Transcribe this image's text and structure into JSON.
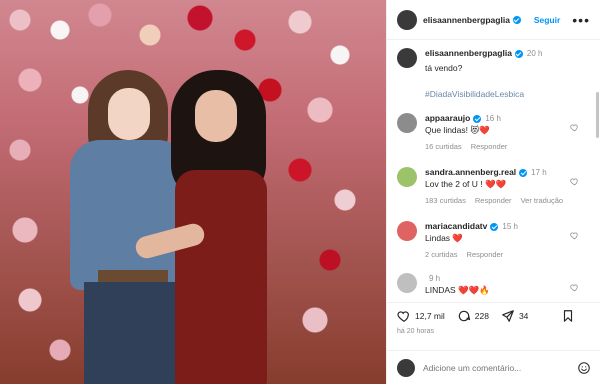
{
  "post": {
    "author": "elisaannenbergpaglia",
    "follow_label": "Seguir",
    "more_label": "•••",
    "caption_time": "20 h",
    "caption_text": "tá vendo?",
    "hashtag": "#DiadaVisibilidadeLesbica",
    "likes": "12,7 mil",
    "comments_count": "228",
    "shares": "34",
    "posted_ago": "há 20 horas",
    "add_comment_placeholder": "Adicione um comentário..."
  },
  "comments": [
    {
      "user": "appaaraujo",
      "verified": true,
      "time": "16 h",
      "text": "Que lindas! 😻❤️",
      "likes": "16 curtidas",
      "reply": "Responder",
      "translate": ""
    },
    {
      "user": "sandra.annenberg.real",
      "verified": true,
      "time": "17 h",
      "text": "Lov the 2 of U ! ❤️❤️",
      "likes": "183 curtidas",
      "reply": "Responder",
      "translate": "Ver tradução"
    },
    {
      "user": "mariacandidatv",
      "verified": true,
      "time": "15 h",
      "text": "Lindas ❤️",
      "likes": "2 curtidas",
      "reply": "Responder",
      "translate": ""
    },
    {
      "user": "",
      "verified": false,
      "time": "9 h",
      "text": "LINDAS ❤️❤️🔥",
      "likes": "",
      "reply": "",
      "translate": ""
    }
  ],
  "icons": {
    "like": "heart-icon",
    "comment": "comment-icon",
    "share": "share-icon",
    "save": "bookmark-icon",
    "emoji": "smiley-icon"
  }
}
